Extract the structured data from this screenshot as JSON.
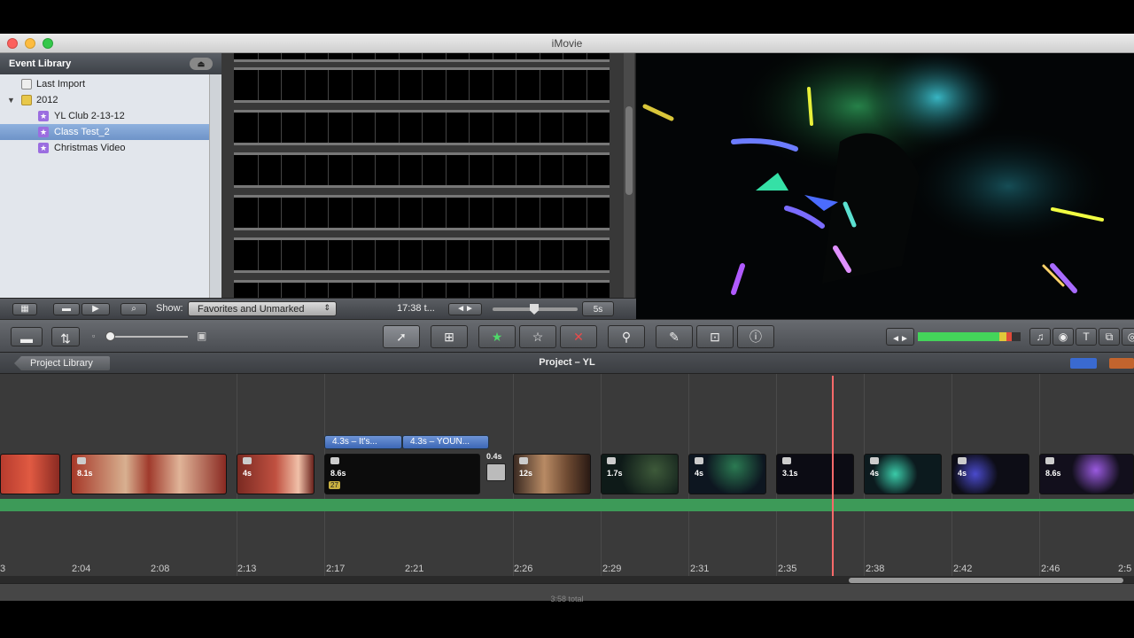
{
  "window": {
    "title": "iMovie"
  },
  "event_library": {
    "header": "Event Library",
    "items": [
      {
        "label": "Last Import",
        "icon": "film-icon"
      },
      {
        "label": "2012",
        "icon": "folder-icon"
      },
      {
        "label": "YL Club 2-13-12",
        "icon": "star-event-icon"
      },
      {
        "label": "Class Test_2",
        "icon": "star-event-icon",
        "selected": true
      },
      {
        "label": "Christmas Video",
        "icon": "star-event-icon"
      }
    ]
  },
  "event_toolbar": {
    "show_label": "Show:",
    "show_filter": "Favorites and Unmarked",
    "duration_readout": "17:38 t...",
    "thumb_duration": "5s"
  },
  "project": {
    "library_button": "Project Library",
    "title": "Project – YL"
  },
  "clips": [
    {
      "duration": "",
      "color": "#b73c2e"
    },
    {
      "duration": "8.1s",
      "color": "#9e3a2c"
    },
    {
      "duration": "4s",
      "color": "#a8473a"
    },
    {
      "duration": "8.6s",
      "color": "#111111"
    },
    {
      "duration": "12s",
      "color": "#8c5a3f"
    },
    {
      "duration": "1.7s",
      "color": "#0e1a18"
    },
    {
      "duration": "4s",
      "color": "#0d1620"
    },
    {
      "duration": "3.1s",
      "color": "#0c0c14"
    },
    {
      "duration": "4s",
      "color": "#0c1a1e"
    },
    {
      "duration": "4s",
      "color": "#0d0d16"
    },
    {
      "duration": "8.6s",
      "color": "#120f1c"
    }
  ],
  "titles": [
    {
      "label": "4.3s – It's..."
    },
    {
      "label": "4.3s – YOUN..."
    }
  ],
  "transition": {
    "duration": "0.4s"
  },
  "clip_badge": "27",
  "ruler": [
    "3",
    "2:04",
    "2:08",
    "2:13",
    "2:17",
    "2:21",
    "2:26",
    "2:29",
    "2:31",
    "2:35",
    "2:38",
    "2:42",
    "2:46",
    "2:5"
  ],
  "footer": {
    "total": "3:58 total"
  },
  "colors": {
    "accent_green": "#3d9a58",
    "playhead": "#ff6a6a",
    "selection": "#7fa2d3"
  }
}
